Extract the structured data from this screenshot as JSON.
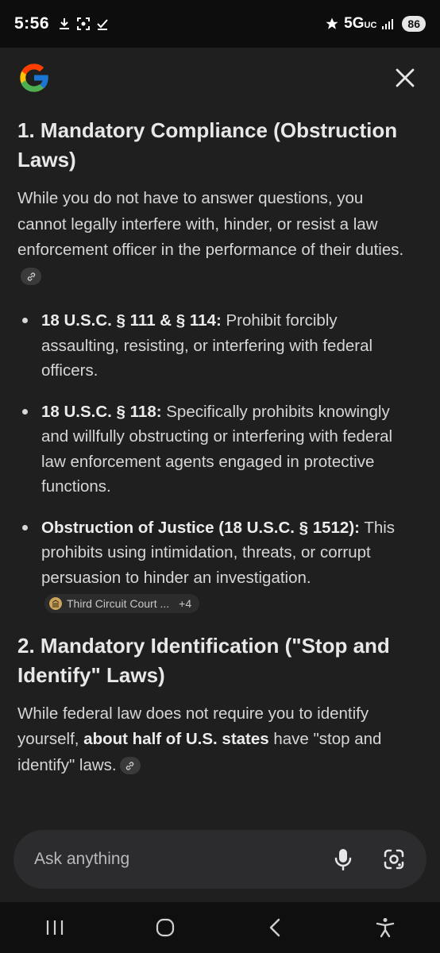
{
  "status": {
    "time": "5:56",
    "network": "5G",
    "network_sub": "UC",
    "battery": "86"
  },
  "header": {
    "logo_icon": "google-g-icon",
    "close_icon": "close-icon"
  },
  "section1": {
    "title": "1. Mandatory Compliance (Obstruction Laws)",
    "intro": "While you do not have to answer questions, you cannot legally interfere with, hinder, or resist a law enforcement officer in the performance of their duties.",
    "bullets": [
      {
        "bold": "18 U.S.C. § 111 & § 114:",
        "text": " Prohibit forcibly assaulting, resisting, or interfering with federal officers."
      },
      {
        "bold": "18 U.S.C. § 118:",
        "text": " Specifically prohibits knowingly and willfully obstructing or interfering with federal law enforcement agents engaged in protective functions."
      },
      {
        "bold": "Obstruction of Justice (18 U.S.C. § 1512):",
        "text": " This prohibits using intimidation, threats, or corrupt persuasion to hinder an investigation."
      }
    ],
    "source_chip": {
      "label": "Third Circuit Court ...",
      "count": "+4"
    }
  },
  "section2": {
    "title": "2. Mandatory Identification (\"Stop and Identify\" Laws)",
    "intro_before": "While federal law does not require you to identify yourself, ",
    "intro_bold": "about half of U.S. states",
    "intro_after": " have \"stop and identify\" laws."
  },
  "ask": {
    "placeholder": "Ask anything"
  },
  "colors": {
    "background": "#1f1f1f",
    "text": "#d6d6d6",
    "ask_bar": "#2c2c2e"
  }
}
